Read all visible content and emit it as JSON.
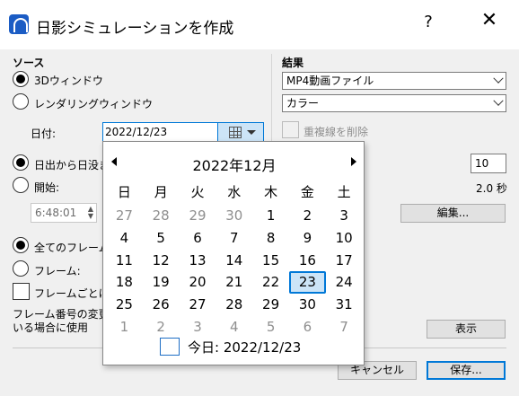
{
  "window": {
    "title": "日影シミュレーションを作成",
    "help_label": "?",
    "close_label": "✕"
  },
  "source": {
    "heading": "ソース",
    "option_3d": "3Dウィンドウ",
    "option_render": "レンダリングウィンドウ",
    "date_label": "日付:",
    "date_value": "2022/12/23",
    "sunrise_option": "日出から日没ま",
    "start_option": "開始:",
    "start_time": "6:48:01"
  },
  "frames": {
    "all_frames": "全てのフレーム",
    "frame_option": "フレーム:",
    "per_frame_checkbox": "フレームごとにモ",
    "note_line1": "フレーム番号の変更月",
    "note_line2": "いる場合に使用"
  },
  "result": {
    "heading": "結果",
    "format_value": "MP4動画ファイル",
    "color_value": "カラー",
    "remove_hidden_label": "重複線を削除",
    "frames_value": "10",
    "seconds_label": "2.0 秒",
    "edit_button": "編集...",
    "show_button": "表示"
  },
  "footer": {
    "cancel_button": "キャンセル",
    "save_button": "保存..."
  },
  "calendar": {
    "month_title": "2022年12月",
    "weekdays": [
      "日",
      "月",
      "火",
      "水",
      "木",
      "金",
      "土"
    ],
    "weeks": [
      [
        "27",
        "28",
        "29",
        "30",
        "1",
        "2",
        "3"
      ],
      [
        "4",
        "5",
        "6",
        "7",
        "8",
        "9",
        "10"
      ],
      [
        "11",
        "12",
        "13",
        "14",
        "15",
        "16",
        "17"
      ],
      [
        "18",
        "19",
        "20",
        "21",
        "22",
        "23",
        "24"
      ],
      [
        "25",
        "26",
        "27",
        "28",
        "29",
        "30",
        "31"
      ],
      [
        "1",
        "2",
        "3",
        "4",
        "5",
        "6",
        "7"
      ]
    ],
    "selected_day": "23",
    "today_label": "今日: 2022/12/23"
  },
  "colors": {
    "accent": "#0078d7",
    "selected_bg": "#cce4f7",
    "muted_text": "#8f8f8f"
  }
}
